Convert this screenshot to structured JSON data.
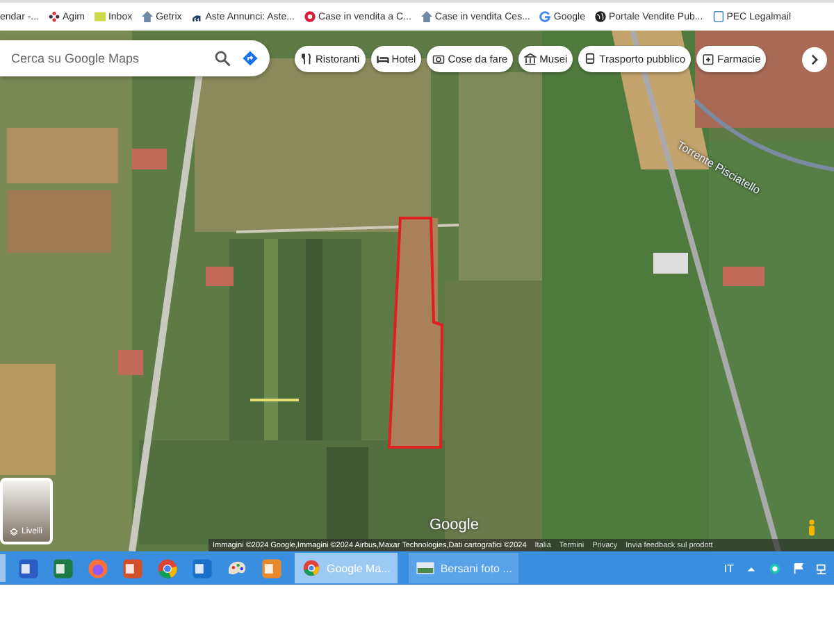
{
  "bookmarks": [
    {
      "label": "endar -..."
    },
    {
      "label": "Agim",
      "kind": "dots"
    },
    {
      "label": "Inbox",
      "kind": "badge"
    },
    {
      "label": "Getrix",
      "kind": "house"
    },
    {
      "label": "Aste Annunci: Aste...",
      "kind": "letter"
    },
    {
      "label": "Case in vendita a C...",
      "kind": "target"
    },
    {
      "label": "Case in vendita Ces...",
      "kind": "house"
    },
    {
      "label": "Google",
      "kind": "g"
    },
    {
      "label": "Portale Vendite Pub...",
      "kind": "globe"
    },
    {
      "label": "PEC Legalmail",
      "kind": "doc"
    }
  ],
  "search": {
    "placeholder": "Cerca su Google Maps"
  },
  "chips": [
    {
      "label": "Ristoranti",
      "kind": "fork"
    },
    {
      "label": "Hotel",
      "kind": "bed"
    },
    {
      "label": "Cose da fare",
      "kind": "camera"
    },
    {
      "label": "Musei",
      "kind": "museum"
    },
    {
      "label": "Trasporto pubblico",
      "kind": "bus"
    },
    {
      "label": "Farmacie",
      "kind": "pharmacy"
    }
  ],
  "map_labels": [
    {
      "text": "Torrente Pisciatello"
    }
  ],
  "layers_button": {
    "label": "Livelli"
  },
  "logo": "Google",
  "attribution": {
    "credits": "Immagini ©2024 Google,Immagini ©2024 Airbus,Maxar Technologies,Dati cartografici ©2024",
    "links": [
      "Italia",
      "Termini",
      "Privacy",
      "Invia feedback sul prodott"
    ]
  },
  "taskbar": {
    "apps": [
      {
        "kind": "word"
      },
      {
        "kind": "excel"
      },
      {
        "kind": "firefox"
      },
      {
        "kind": "powerpoint"
      },
      {
        "kind": "chrome"
      },
      {
        "kind": "outlook"
      },
      {
        "kind": "paint"
      },
      {
        "kind": "player"
      }
    ],
    "tasks": [
      {
        "label": "Google Ma...",
        "kind": "chrome",
        "selected": true
      },
      {
        "label": "Bersani foto ...",
        "kind": "photo",
        "selected": false
      }
    ],
    "language": "IT"
  }
}
